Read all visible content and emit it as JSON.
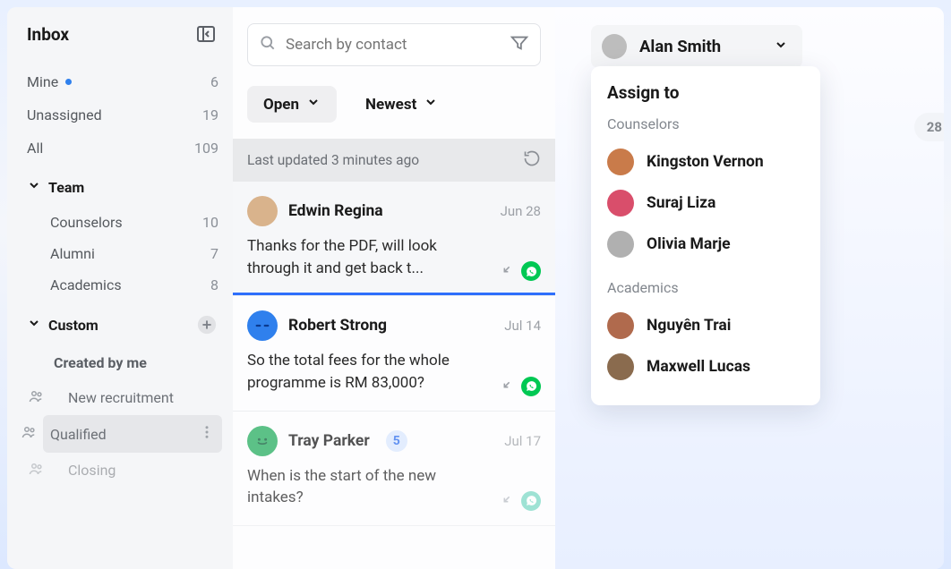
{
  "sidebar": {
    "title": "Inbox",
    "filters": {
      "mine": {
        "label": "Mine",
        "count": "6"
      },
      "unassigned": {
        "label": "Unassigned",
        "count": "19"
      },
      "all": {
        "label": "All",
        "count": "109"
      }
    },
    "team_section_label": "Team",
    "teams": {
      "counselors": {
        "label": "Counselors",
        "count": "10"
      },
      "alumni": {
        "label": "Alumni",
        "count": "7"
      },
      "academics": {
        "label": "Academics",
        "count": "8"
      }
    },
    "custom_section_label": "Custom",
    "custom": {
      "created_by_me": "Created by me",
      "new_recruitment": "New recruitment",
      "qualified": "Qualified",
      "closing": "Closing"
    }
  },
  "conversation_list": {
    "search_placeholder": "Search by contact",
    "open_label": "Open",
    "newest_label": "Newest",
    "updated_text": "Last updated 3 minutes ago",
    "items": [
      {
        "name": "Edwin Regina",
        "date": "Jun 28",
        "preview": "Thanks for the PDF, will look through it and get back t...",
        "avatar_bg": "#d9b38c",
        "wa_color": "#00c853"
      },
      {
        "name": "Robert Strong",
        "date": "Jul 14",
        "preview": "So the total fees for the whole programme is RM 83,000?",
        "avatar_bg": "#2f80ed",
        "wa_color": "#00c853"
      },
      {
        "name": "Tray Parker",
        "date": "Jul 17",
        "preview": "When is the start of the new intakes?",
        "avatar_bg": "#27ae60",
        "unread": "5",
        "wa_color": "#7fd9c7"
      }
    ]
  },
  "assignee": {
    "selected": "Alan Smith",
    "avatar_bg": "#bdbdbd",
    "dropdown_title": "Assign to",
    "sections": [
      {
        "label": "Counselors",
        "people": [
          {
            "name": "Kingston Vernon",
            "avatar_bg": "#c97b4a"
          },
          {
            "name": "Suraj Liza",
            "avatar_bg": "#d94e6b"
          },
          {
            "name": "Olivia Marje",
            "avatar_bg": "#b0b0b0"
          }
        ]
      },
      {
        "label": "Academics",
        "people": [
          {
            "name": "Nguyên Trai",
            "avatar_bg": "#b06a4d"
          },
          {
            "name": "Maxwell Lucas",
            "avatar_bg": "#8a6b4e"
          }
        ]
      }
    ]
  },
  "date_pill": "28"
}
